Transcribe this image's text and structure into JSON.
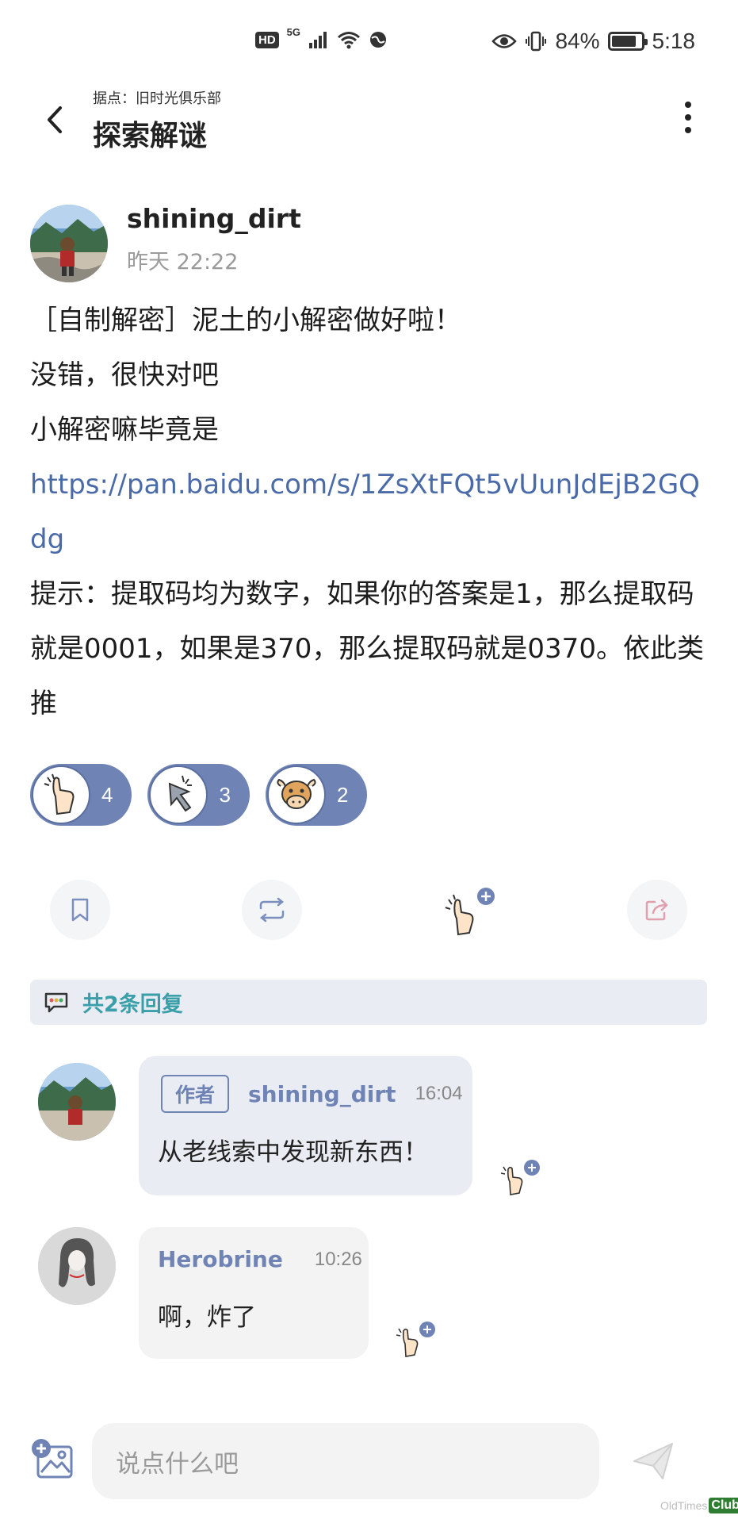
{
  "status_bar": {
    "hd": "HD",
    "network": "5G",
    "battery": "84%",
    "time": "5:18",
    "battery_level": 0.84
  },
  "header": {
    "subtitle": "据点：旧时光俱乐部",
    "title": "探索解谜",
    "back_icon": "chevron-left-icon",
    "more_icon": "more-vertical-icon"
  },
  "post": {
    "author": "shining_dirt",
    "time": "昨天 22:22",
    "lines": [
      "［自制解密］泥土的小解密做好啦！",
      "没错，很快对吧",
      "小解密嘛毕竟是"
    ],
    "link": "https://pan.baidu.com/s/1ZsXtFQt5vUunJdEjB2GQdg",
    "hint": "提示：提取码均为数字，如果你的答案是1，那么提取码就是0001，如果是370，那么提取码就是0370。依此类推"
  },
  "reactions": [
    {
      "icon": "thumbs-up-icon",
      "count": "4"
    },
    {
      "icon": "cursor-click-icon",
      "count": "3"
    },
    {
      "icon": "cow-face-icon",
      "count": "2"
    }
  ],
  "actions": {
    "bookmark_icon": "bookmark-icon",
    "repost_icon": "repost-icon",
    "like_icon": "thumbs-up-plus-icon",
    "share_icon": "share-icon"
  },
  "replies": {
    "header": "共2条回复",
    "items": [
      {
        "tag": "作者",
        "name": "shining_dirt",
        "time": "16:04",
        "text": "从老线索中发现新东西！"
      },
      {
        "name": "Herobrine",
        "time": "10:26",
        "text": "啊，炸了"
      }
    ]
  },
  "composer": {
    "placeholder": "说点什么吧",
    "image_icon": "add-image-icon",
    "send_icon": "send-icon"
  },
  "watermark": {
    "text": "OldTimes",
    "badge": "Club"
  },
  "colors": {
    "accent": "#6f84b4",
    "link": "#4a6ba8",
    "reply_header_text": "#3a9fa8",
    "bubble": "#e9ecf3"
  }
}
